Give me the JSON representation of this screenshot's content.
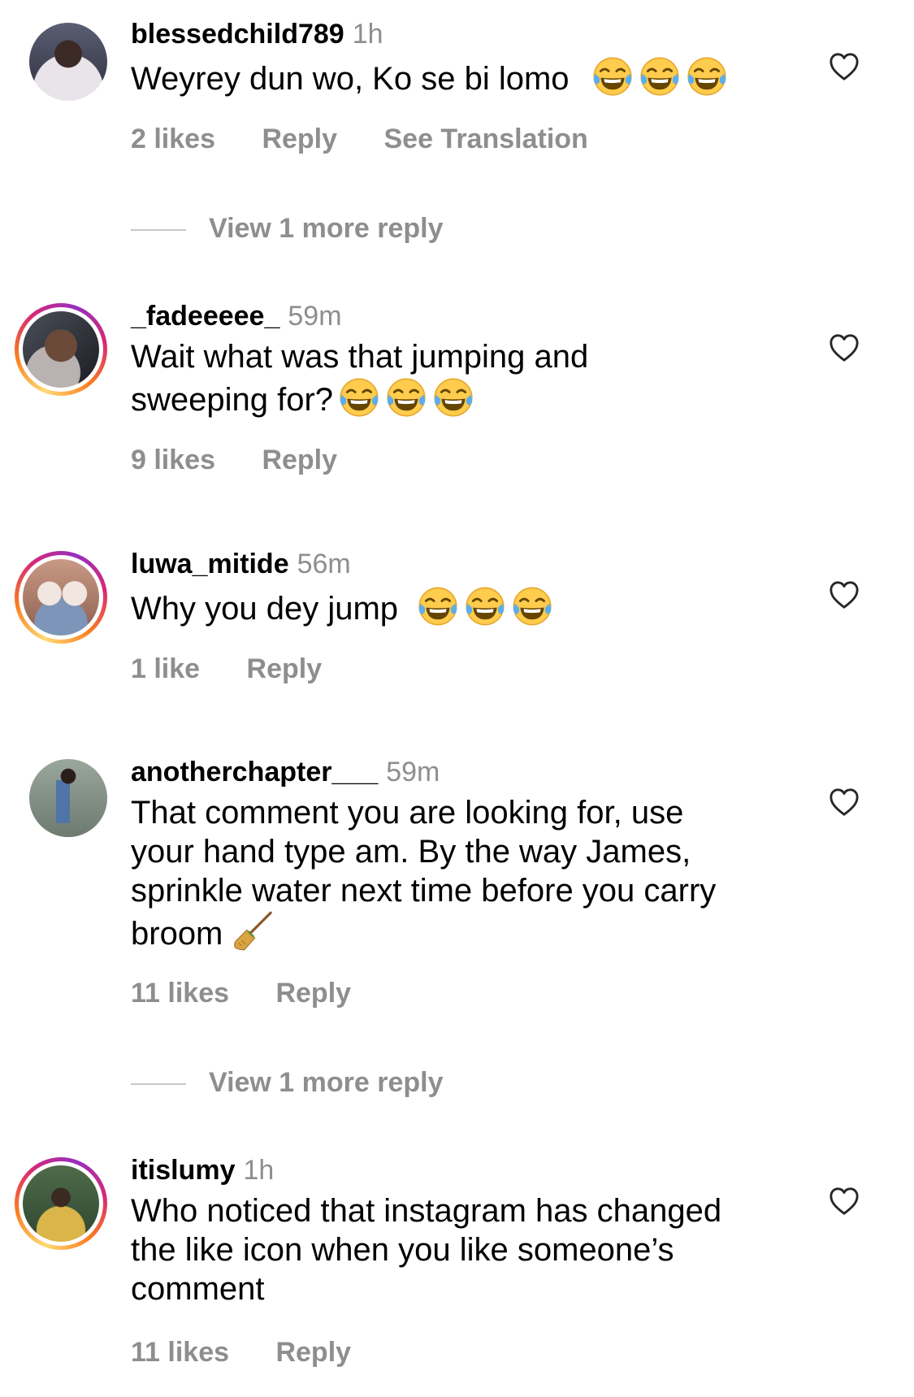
{
  "comments": [
    {
      "username": "blessedchild789",
      "time": "1h",
      "text": "Weyrey dun wo, Ko se bi lomo",
      "emoji": [
        "face-with-tears-of-joy",
        "face-with-tears-of-joy",
        "face-with-tears-of-joy"
      ],
      "likes": "2 likes",
      "reply": "Reply",
      "translation": "See Translation",
      "more_replies": "View 1 more reply",
      "story_ring": false
    },
    {
      "username": "_fadeeeee_",
      "time": "59m",
      "text_line1": "Wait what was that jumping and",
      "text_line2": "sweeping for?",
      "emoji": [
        "face-with-tears-of-joy",
        "face-with-tears-of-joy",
        "face-with-tears-of-joy"
      ],
      "likes": "9 likes",
      "reply": "Reply",
      "story_ring": true
    },
    {
      "username": "luwa_mitide",
      "time": "56m",
      "text": "Why you dey jump",
      "emoji": [
        "face-with-tears-of-joy",
        "face-with-tears-of-joy",
        "face-with-tears-of-joy"
      ],
      "likes": "1 like",
      "reply": "Reply",
      "story_ring": true
    },
    {
      "username": "anotherchapter___",
      "time": "59m",
      "text_line1": "That comment you are looking for, use",
      "text_line2": "your hand type am. By the way James,",
      "text_line3": "sprinkle water next time before you carry",
      "text_line4": "broom",
      "emoji": [
        "broom"
      ],
      "likes": "11 likes",
      "reply": "Reply",
      "more_replies": "View 1 more reply",
      "story_ring": false
    },
    {
      "username": "itislumy",
      "time": "1h",
      "text_line1": "Who noticed that instagram has changed",
      "text_line2": "the like icon when you like someone’s",
      "text_line3": "comment",
      "likes": "11 likes",
      "reply": "Reply",
      "story_ring": true
    }
  ],
  "icons": {
    "like": "heart-outline-icon"
  },
  "colors": {
    "secondary_text": "#8e8e8e",
    "primary_text": "#000000",
    "story_ring": [
      "#feda75",
      "#fa7e1e",
      "#d62976",
      "#962fbf"
    ]
  }
}
